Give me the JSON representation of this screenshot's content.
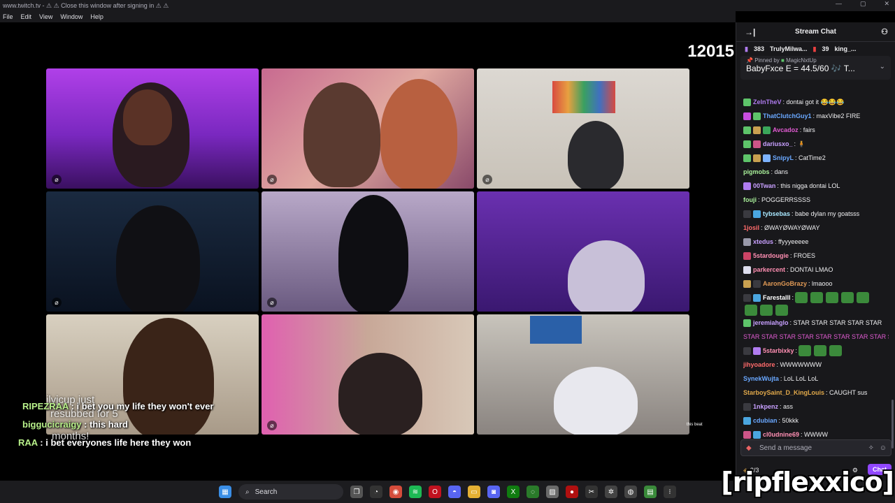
{
  "window": {
    "title": "www.twitch.tv - ⚠ ⚠ Close this window after signing in ⚠ ⚠",
    "controls": [
      "—",
      "▢",
      "✕"
    ]
  },
  "menu": [
    "File",
    "Edit",
    "View",
    "Window",
    "Help"
  ],
  "stream": {
    "counter": "12015",
    "overlay_chat": [
      {
        "user": "RIPEZRAA",
        "text": " : i bet you my life they won't ever"
      },
      {
        "user": "biggucicraigy",
        "text": " : this hard"
      },
      {
        "user": "RAA",
        "text": " : i bet everyones life here they won"
      }
    ],
    "ghost_text": [
      "ilyjcup just",
      "resubbed for 5",
      "months!"
    ],
    "small_caption": "this beat"
  },
  "chat": {
    "header": "Stream Chat",
    "collapse_icon": "→|",
    "users_icon": "person-icon",
    "gift_bar": [
      {
        "count": "383",
        "user": "TrulyMilwa..."
      },
      {
        "count": "39",
        "user": "king_..."
      }
    ],
    "pinned": {
      "by_prefix": "Pinned by",
      "by_user": "MagicNxtUp",
      "message": "BabyFxce E = 44.5/60 🎶 T..."
    },
    "messages": [
      {
        "user": "ZelnTheV",
        "color": "#b07cf0",
        "badges": [
          "#5ec46a"
        ],
        "text": ": dontai got it 😂😂😂"
      },
      {
        "user": "ThatClutchGuy1",
        "color": "#6aa8ff",
        "badges": [
          "#c94ee0",
          "#5ec46a"
        ],
        "text": ": maxVibe2 FIRE"
      },
      {
        "user": "Avcadoz",
        "color": "#e05bd1",
        "badges": [
          "#5ec46a",
          "#c9a050",
          "#3aa65a"
        ],
        "text": ": fairs"
      },
      {
        "user": "dariusxo_",
        "color": "#c8a0ff",
        "badges": [
          "#5ec46a",
          "#cc5588"
        ],
        "text": ": 🧍"
      },
      {
        "user": "SnipyL",
        "color": "#6aa8ff",
        "badges": [
          "#5ec46a",
          "#c9a050",
          "#7db3ff"
        ],
        "text": ": CatTime2"
      },
      {
        "user": "pigmobs",
        "color": "#a9f09a",
        "badges": [],
        "text": ": dans"
      },
      {
        "user": "00Twan",
        "color": "#c8a0ff",
        "badges": [
          "#b07cf0"
        ],
        "text": ": this nigga dontai LOL"
      },
      {
        "user": "fouji",
        "color": "#a9f09a",
        "badges": [],
        "text": ": POGGERRSSSS"
      },
      {
        "user": "tybsebas",
        "color": "#a9e8ff",
        "badges": [
          "#3a3a40",
          "#4aa6e0"
        ],
        "text": ": babe dylan my goatsss"
      },
      {
        "user": "1josil",
        "color": "#ff6b6b",
        "badges": [],
        "text": ": ØWAYØWAYØWAY"
      },
      {
        "user": "xtedus",
        "color": "#c8a0ff",
        "badges": [
          "#9999aa"
        ],
        "text": ": ffyyyeeeee"
      },
      {
        "user": "5stardougie",
        "color": "#ff8fb3",
        "badges": [
          "#cc4466"
        ],
        "text": ": FROES"
      },
      {
        "user": "parkercent",
        "color": "#ff8fb3",
        "badges": [
          "#ddddee"
        ],
        "text": ": DONTAI LMAO"
      },
      {
        "user": "AaronGoBrazy",
        "color": "#e09955",
        "badges": [
          "#c9a050",
          "#3a3a40"
        ],
        "text": ": lmaooo"
      },
      {
        "user": "Farestalll",
        "color": "#ffffff",
        "badges": [
          "#3a3a40",
          "#4aa6e0"
        ],
        "text": ":",
        "emotes": 5
      },
      {
        "user": "",
        "color": "#ffffff",
        "badges": [],
        "text": "",
        "emotes": 3
      },
      {
        "user": "jeremiahglo",
        "color": "#c8a0ff",
        "badges": [
          "#5ec46a"
        ],
        "text": ": STAR STAR STAR STAR STAR"
      },
      {
        "user": "",
        "color": "#e05bd1",
        "badges": [],
        "text": "STAR STAR STAR STAR STAR STAR STAR STAR STAR"
      },
      {
        "user": "5starbixky",
        "color": "#ff8fb3",
        "badges": [
          "#3a3a40",
          "#b07cf0"
        ],
        "text": ":",
        "emotes": 3
      },
      {
        "user": "jihyoadore",
        "color": "#ff6b6b",
        "badges": [],
        "text": ": WWWWWWW"
      },
      {
        "user": "SynekWujta",
        "color": "#6aa8ff",
        "badges": [],
        "text": ": LoL LoL LoL"
      },
      {
        "user": "StarboySaint_D_KingLouis",
        "color": "#e0a84a",
        "badges": [],
        "text": ": CAUGHT sus"
      },
      {
        "user": "1nkpenz",
        "color": "#c8a0ff",
        "badges": [
          "#3a3a40"
        ],
        "text": ": ass"
      },
      {
        "user": "cdubian",
        "color": "#6aa8ff",
        "badges": [
          "#4aa6e0"
        ],
        "text": ": 50kkk"
      },
      {
        "user": "cl0udnine69",
        "color": "#ff8fb3",
        "badges": [
          "#cc5588",
          "#4aa6e0"
        ],
        "text": ": WWWW"
      }
    ],
    "input_placeholder": "Send a message",
    "points": "2/3",
    "chat_button": "Chat"
  },
  "taskbar": {
    "search_label": "Search",
    "icons": [
      {
        "name": "start-icon",
        "color": "#3a8ee6",
        "glyph": "▦"
      },
      {
        "name": "taskview-icon",
        "color": "#555",
        "glyph": "❐"
      },
      {
        "name": "copilot-icon",
        "color": "#333",
        "glyph": "◔"
      },
      {
        "name": "chrome-icon",
        "color": "#d54c3b",
        "glyph": "◉"
      },
      {
        "name": "spotify-icon",
        "color": "#1db954",
        "glyph": "≋"
      },
      {
        "name": "opera-icon",
        "color": "#c1121f",
        "glyph": "O"
      },
      {
        "name": "discord-icon",
        "color": "#5865f2",
        "glyph": "◓"
      },
      {
        "name": "folder-icon",
        "color": "#e5b033",
        "glyph": "▭"
      },
      {
        "name": "app-icon",
        "color": "#5865f2",
        "glyph": "◙"
      },
      {
        "name": "xbox-icon",
        "color": "#107c10",
        "glyph": "X"
      },
      {
        "name": "gamepad-icon",
        "color": "#2a7a2a",
        "glyph": "◌"
      },
      {
        "name": "game-icon",
        "color": "#6a6a6a",
        "glyph": "▨"
      },
      {
        "name": "record-icon",
        "color": "#b01010",
        "glyph": "●"
      },
      {
        "name": "capcut-icon",
        "color": "#333",
        "glyph": "✂"
      },
      {
        "name": "openai-icon",
        "color": "#444",
        "glyph": "✲"
      },
      {
        "name": "obs-icon",
        "color": "#444",
        "glyph": "◍"
      },
      {
        "name": "app2-icon",
        "color": "#3a8a3a",
        "glyph": "▤"
      },
      {
        "name": "overflow-icon",
        "color": "#333",
        "glyph": "⁝"
      }
    ]
  },
  "watermark": "[ripflexxico]"
}
